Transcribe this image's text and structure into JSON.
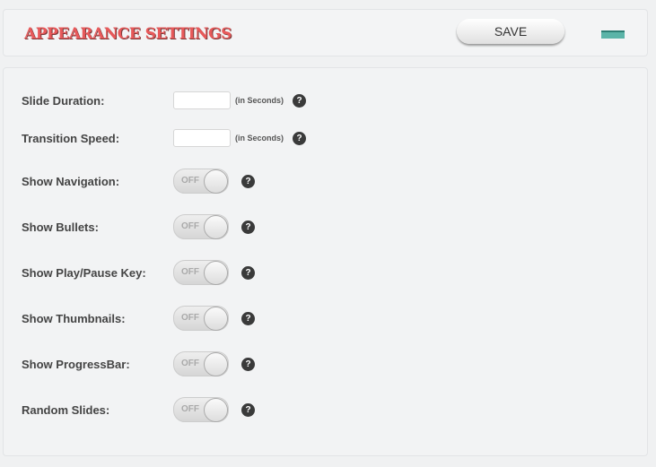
{
  "header": {
    "title": "APPEARANCE SETTINGS",
    "save_label": "SAVE"
  },
  "fields": [
    {
      "label": "Slide Duration:",
      "unit": "(in Seconds)",
      "value": ""
    },
    {
      "label": "Transition Speed:",
      "unit": "(in Seconds)",
      "value": ""
    }
  ],
  "toggles": [
    {
      "label": "Show Navigation:",
      "state": "OFF"
    },
    {
      "label": "Show Bullets:",
      "state": "OFF"
    },
    {
      "label": "Show Play/Pause Key:",
      "state": "OFF"
    },
    {
      "label": "Show Thumbnails:",
      "state": "OFF"
    },
    {
      "label": "Show ProgressBar:",
      "state": "OFF"
    },
    {
      "label": "Random Slides:",
      "state": "OFF"
    }
  ],
  "help_glyph": "?"
}
